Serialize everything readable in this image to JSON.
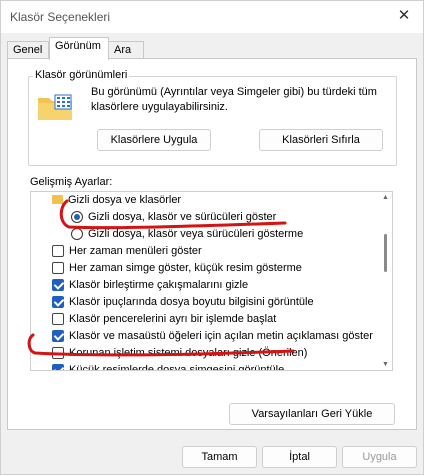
{
  "window": {
    "title": "Klasör Seçenekleri",
    "close_symbol": "✕"
  },
  "tabs": [
    {
      "label": "Genel"
    },
    {
      "label": "Görünüm"
    },
    {
      "label": "Ara"
    }
  ],
  "folder_views": {
    "title": "Klasör görünümleri",
    "description": "Bu görünümü (Ayrıntılar veya Simgeler gibi) bu türdeki tüm klasörlere uygulayabilirsiniz.",
    "apply_button": "Klasörlere Uygula",
    "reset_button": "Klasörleri Sıfırla"
  },
  "advanced": {
    "title": "Gelişmiş Ayarlar:",
    "items": [
      {
        "type": "folder",
        "label": "Gizli dosya ve klasörler"
      },
      {
        "type": "radio",
        "checked": true,
        "label": "Gizli dosya, klasör ve sürücüleri göster"
      },
      {
        "type": "radio",
        "checked": false,
        "label": "Gizli dosya, klasör veya sürücüleri gösterme"
      },
      {
        "type": "checkbox",
        "checked": false,
        "label": "Her zaman menüleri göster"
      },
      {
        "type": "checkbox",
        "checked": false,
        "label": "Her zaman simge göster, küçük resim gösterme"
      },
      {
        "type": "checkbox",
        "checked": true,
        "label": "Klasör birleştirme çakışmalarını gizle"
      },
      {
        "type": "checkbox",
        "checked": true,
        "label": "Klasör ipuçlarında dosya boyutu bilgisini görüntüle"
      },
      {
        "type": "checkbox",
        "checked": false,
        "label": "Klasör pencerelerini ayrı bir işlemde başlat"
      },
      {
        "type": "checkbox",
        "checked": true,
        "label": "Klasör ve masaüstü öğeleri için açılan metin açıklaması göster"
      },
      {
        "type": "checkbox",
        "checked": false,
        "label": "Korunan işletim sistemi dosyaları gizle (Önerilen)"
      },
      {
        "type": "checkbox",
        "checked": true,
        "label": "Küçük resimlerde dosya simgesini görüntüle"
      }
    ],
    "restore_button": "Varsayılanları Geri Yükle"
  },
  "footer": {
    "ok": "Tamam",
    "cancel": "İptal",
    "apply": "Uygula"
  },
  "colors": {
    "accent": "#1f5fbf",
    "annotation": "#d41414"
  }
}
